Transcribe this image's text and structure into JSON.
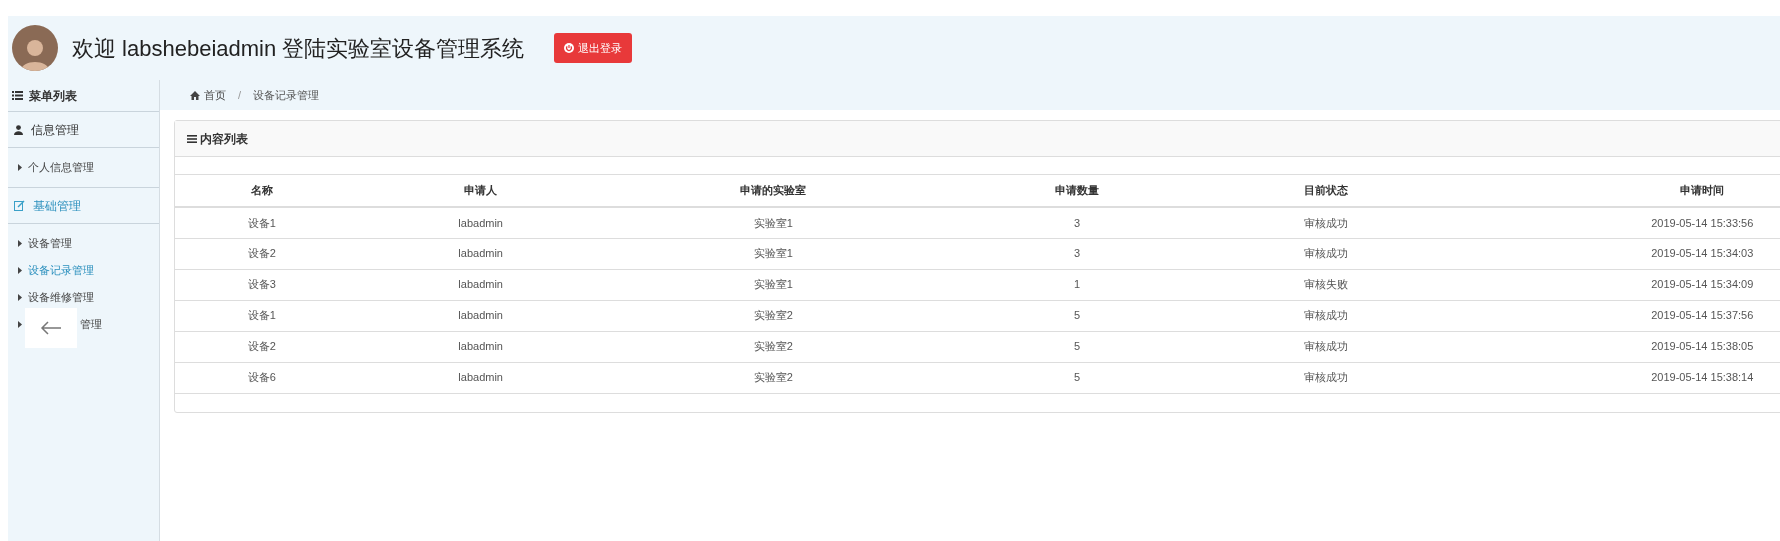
{
  "header": {
    "welcome": "欢迎 labshebeiadmin 登陆实验室设备管理系统",
    "logout_button": "退出登录"
  },
  "sidebar": {
    "title": "菜单列表",
    "groups": [
      {
        "label": "信息管理",
        "active": false,
        "items": [
          {
            "label": "个人信息管理",
            "selected": false
          }
        ]
      },
      {
        "label": "基础管理",
        "active": true,
        "items": [
          {
            "label": "设备管理",
            "selected": false
          },
          {
            "label": "设备记录管理",
            "selected": true
          },
          {
            "label": "设备维修管理",
            "selected": false
          },
          {
            "label": "管理",
            "selected": false,
            "kind": "covered"
          }
        ]
      }
    ]
  },
  "breadcrumb": {
    "separator": "/",
    "items": [
      "首页",
      "设备记录管理"
    ]
  },
  "panel": {
    "title": "内容列表"
  },
  "table": {
    "columns": [
      "名称",
      "申请人",
      "申请的实验室",
      "申请数量",
      "目前状态",
      "申请时间"
    ],
    "rows": [
      [
        "设备1",
        "labadmin",
        "实验室1",
        "3",
        "审核成功",
        "2019-05-14 15:33:56"
      ],
      [
        "设备2",
        "labadmin",
        "实验室1",
        "3",
        "审核成功",
        "2019-05-14 15:34:03"
      ],
      [
        "设备3",
        "labadmin",
        "实验室1",
        "1",
        "审核失败",
        "2019-05-14 15:34:09"
      ],
      [
        "设备1",
        "labadmin",
        "实验室2",
        "5",
        "审核成功",
        "2019-05-14 15:37:56"
      ],
      [
        "设备2",
        "labadmin",
        "实验室2",
        "5",
        "审核成功",
        "2019-05-14 15:38:05"
      ],
      [
        "设备6",
        "labadmin",
        "实验室2",
        "5",
        "审核成功",
        "2019-05-14 15:38:14"
      ]
    ]
  }
}
